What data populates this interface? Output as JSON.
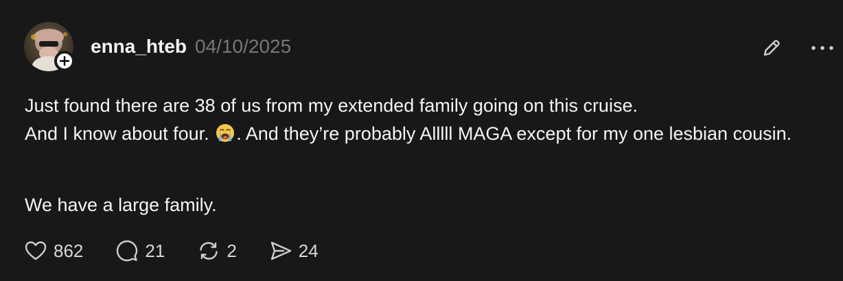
{
  "post": {
    "username": "enna_hteb",
    "date": "04/10/2025",
    "text_line1a": "Just found there are 38 of us from my extended family going on this cruise.",
    "text_line1b": "And I know about four.",
    "text_line1c": ". And they’re probably Alllll MAGA except for my one lesbian cousin.",
    "text_para2": "We have a large family.",
    "emoji_icon": "loudly-crying-face-icon"
  },
  "actions": {
    "likes": "862",
    "replies": "21",
    "reposts": "2",
    "shares": "24"
  },
  "colors": {
    "background": "#181818",
    "text": "#f3f5f7",
    "muted": "#777777",
    "icon": "#cfcfcf"
  }
}
